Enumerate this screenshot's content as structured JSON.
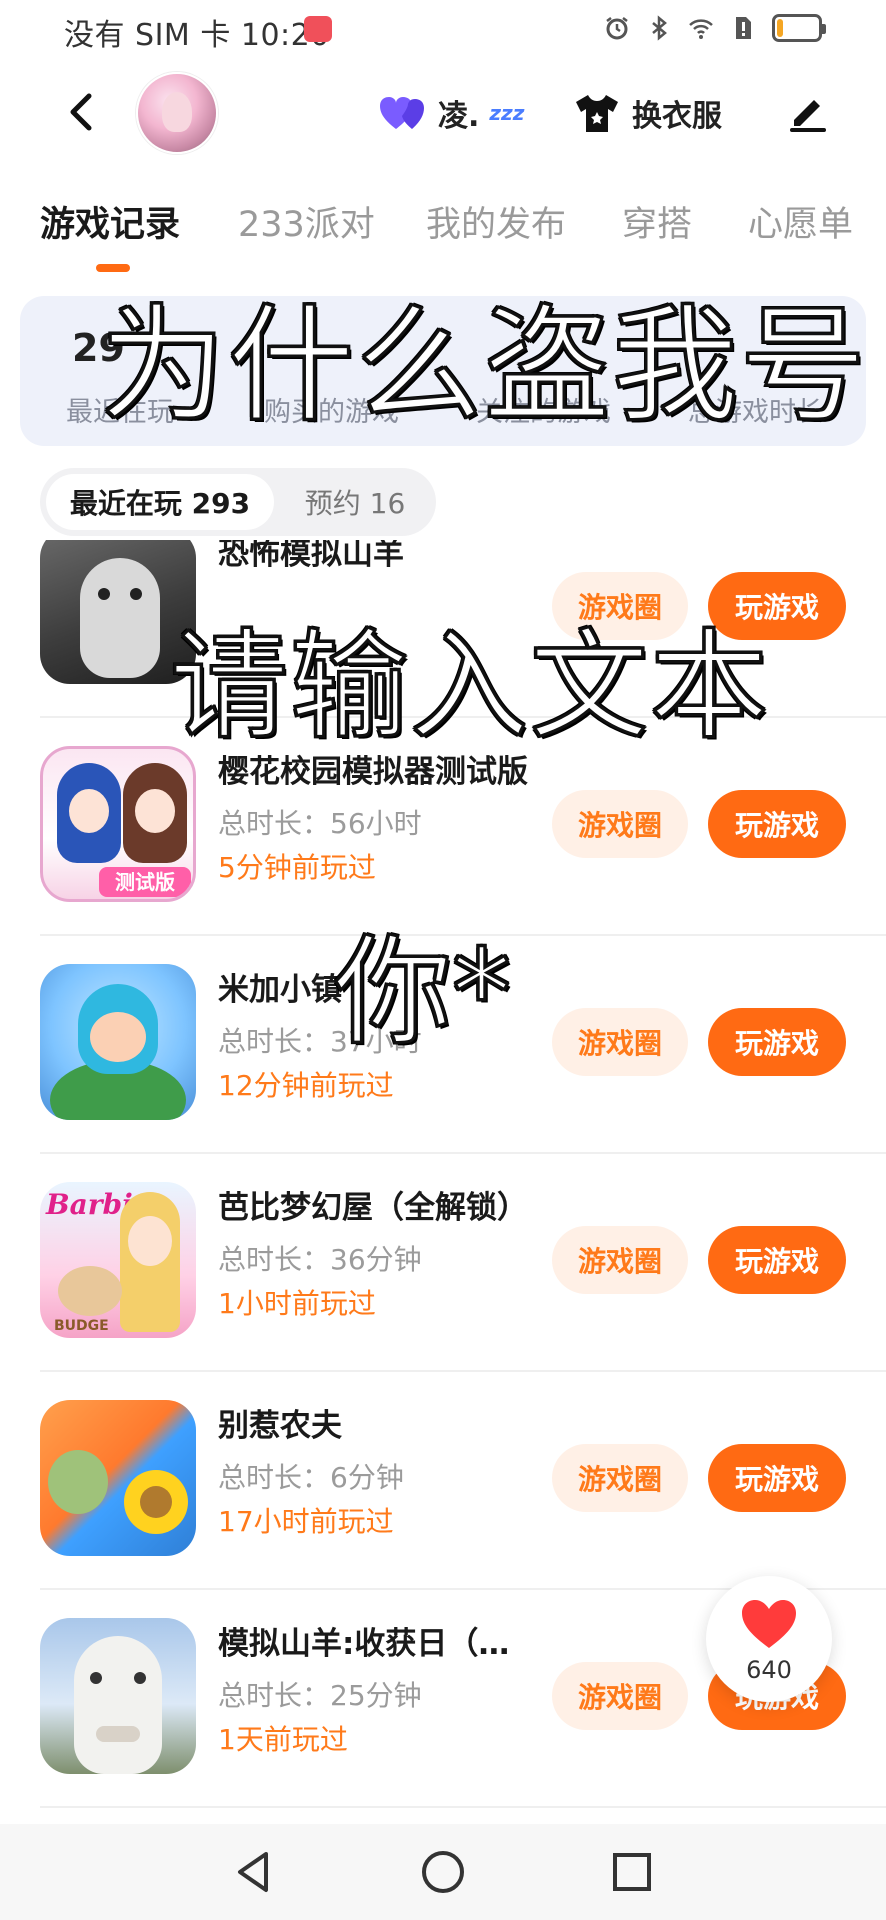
{
  "status_bar": {
    "carrier_time": "没有 SIM 卡 10:20",
    "icons": [
      "alarm-icon",
      "bluetooth-icon",
      "wifi-icon",
      "sim-alert-icon",
      "battery-icon"
    ],
    "battery_level": 0.15
  },
  "header": {
    "back_icon": "chevron-left-icon",
    "friend": {
      "icon": "heart-pair-icon",
      "name": "凌.",
      "status_emoji": "zzz"
    },
    "outfit_label": "换衣服",
    "edit_icon": "pen-icon"
  },
  "tabs": [
    "游戏记录",
    "233派对",
    "我的发布",
    "穿搭",
    "心愿单"
  ],
  "stats": {
    "recent_value": "29",
    "labels": [
      "最近在玩",
      "购买的游戏",
      "关注的游戏",
      "总游戏时长"
    ]
  },
  "segment": {
    "recent_label": "最近在玩 293",
    "reserve_label": "预约 16"
  },
  "buttons": {
    "circle_label": "游戏圈",
    "play_label": "玩游戏"
  },
  "games": [
    {
      "title": "恐怖模拟山羊",
      "duration": "",
      "last_played": ""
    },
    {
      "title": "樱花校园模拟器测试版",
      "duration": "总时长：56小时",
      "last_played": "5分钟前玩过"
    },
    {
      "title": "米加小镇",
      "duration": "总时长：37小时",
      "last_played": "12分钟前玩过"
    },
    {
      "title": "芭比梦幻屋（全解锁）",
      "duration": "总时长：36分钟",
      "last_played": "1小时前玩过"
    },
    {
      "title": "别惹农夫",
      "duration": "总时长：6分钟",
      "last_played": "17小时前玩过"
    },
    {
      "title": "模拟山羊:收获日（…",
      "duration": "总时长：25分钟",
      "last_played": "1天前玩过"
    }
  ],
  "icon_badges": {
    "sakura_badge": "测试版",
    "barbie_logo": "Barbie",
    "barbie_dog": "BUDGE"
  },
  "overlay_captions": [
    "为什么盗我号",
    "请输入文本",
    "你*"
  ],
  "like": {
    "count": "640"
  },
  "accent_color": "#ff6a13",
  "nav_bar": {
    "icons": [
      "back-triangle-icon",
      "home-circle-icon",
      "recents-square-icon"
    ]
  }
}
